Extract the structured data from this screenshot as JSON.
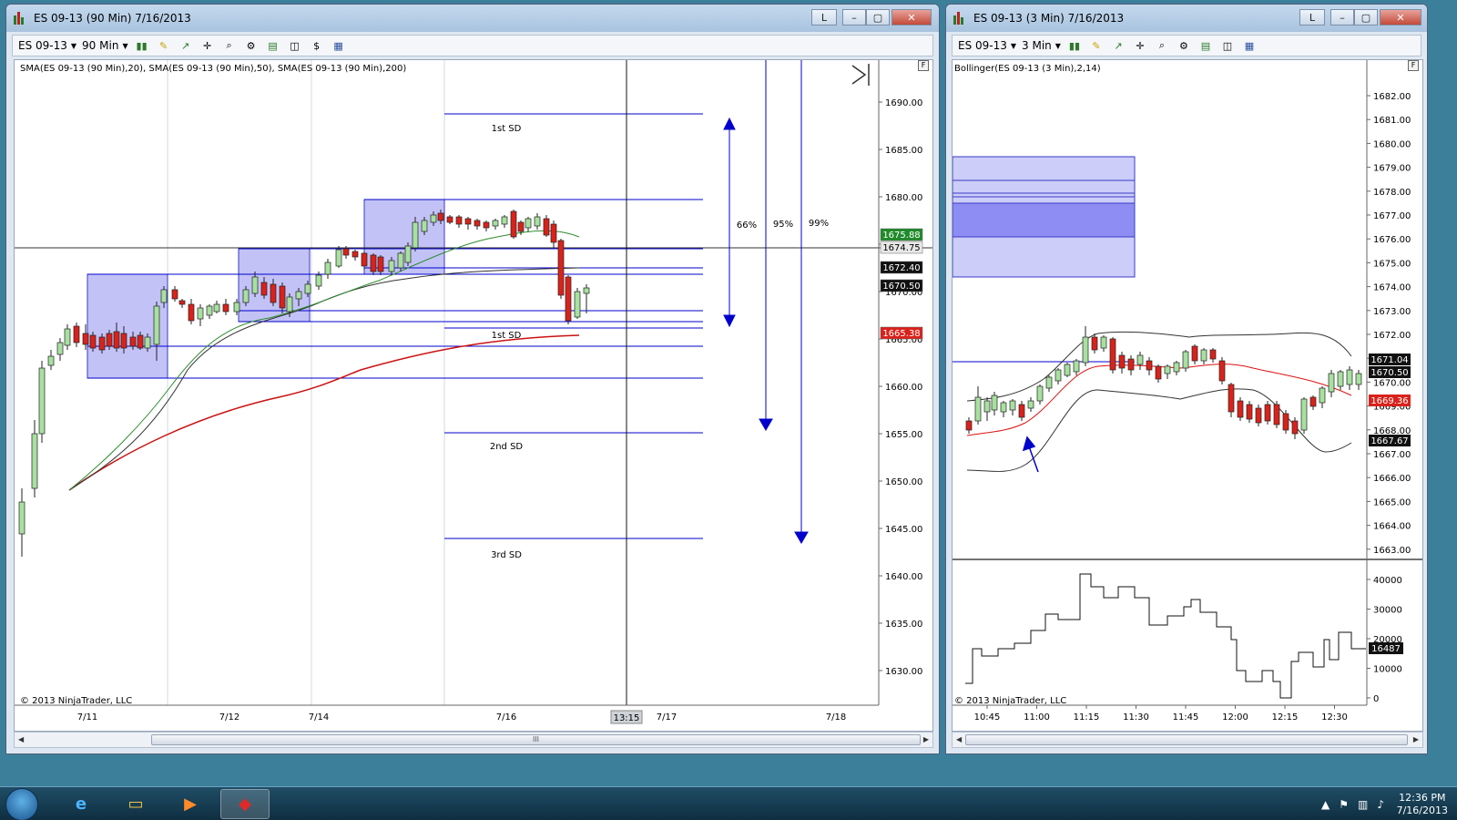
{
  "colors": {
    "up": "#a8e0a0",
    "down": "#d9221b",
    "band": "#0000cc",
    "sma20": "#2e8b2e",
    "sma50": "#333333",
    "sma200": "#cc1111"
  },
  "left_window": {
    "title": "ES 09-13 (90 Min)  7/16/2013",
    "toolbar": {
      "instrument": "ES 09-13",
      "period": "90 Min"
    },
    "indicator_label": "SMA(ES 09-13 (90 Min),20), SMA(ES 09-13 (90 Min),50), SMA(ES 09-13 (90 Min),200)",
    "copyright": "© 2013 NinjaTrader, LLC",
    "f_button": "F",
    "scroll_label": "III",
    "price_ticks": [
      "1690.00",
      "1685.00",
      "1680.00",
      "1675.00",
      "1670.00",
      "1665.00",
      "1660.00",
      "1655.00",
      "1650.00",
      "1645.00",
      "1640.00",
      "1635.00",
      "1630.00"
    ],
    "price_tags": [
      {
        "value": "1675.88",
        "color": "#1f8a2a"
      },
      {
        "value": "1674.75",
        "color": "#e8e8e8"
      },
      {
        "value": "1672.40",
        "color": "#111111"
      },
      {
        "value": "1670.50",
        "color": "#111111"
      },
      {
        "value": "1665.38",
        "color": "#d9221b"
      }
    ],
    "date_ticks": [
      "7/11",
      "7/12",
      "7/14",
      "7/16",
      "7/17",
      "7/18"
    ],
    "cursor_time": "13:15",
    "sd_labels": [
      "1st SD",
      "1st SD",
      "2nd SD",
      "3rd SD"
    ],
    "pct_labels": [
      "66%",
      "95%",
      "99%"
    ]
  },
  "right_window": {
    "title": "ES 09-13 (3 Min)  7/16/2013",
    "toolbar": {
      "instrument": "ES 09-13",
      "period": "3 Min"
    },
    "indicator_label": "Bollinger(ES 09-13 (3 Min),2,14)",
    "copyright": "© 2013 NinjaTrader, LLC",
    "f_button": "F",
    "price_ticks": [
      "1682.00",
      "1681.00",
      "1680.00",
      "1679.00",
      "1678.00",
      "1677.00",
      "1676.00",
      "1675.00",
      "1674.00",
      "1673.00",
      "1672.00",
      "1671.00",
      "1670.00",
      "1669.00",
      "1668.00",
      "1667.00",
      "1666.00",
      "1665.00",
      "1664.00",
      "1663.00"
    ],
    "price_tags": [
      {
        "value": "1671.04",
        "color": "#111111"
      },
      {
        "value": "1670.50",
        "color": "#111111"
      },
      {
        "value": "1669.36",
        "color": "#d9221b"
      },
      {
        "value": "1667.67",
        "color": "#111111"
      }
    ],
    "volume_ticks": [
      "40000",
      "30000",
      "20000",
      "10000",
      "0"
    ],
    "volume_tag": "16487",
    "time_ticks": [
      "10:45",
      "11:00",
      "11:15",
      "11:30",
      "11:45",
      "12:00",
      "12:15",
      "12:30"
    ]
  },
  "taskbar": {
    "time": "12:36 PM",
    "date": "7/16/2013"
  }
}
